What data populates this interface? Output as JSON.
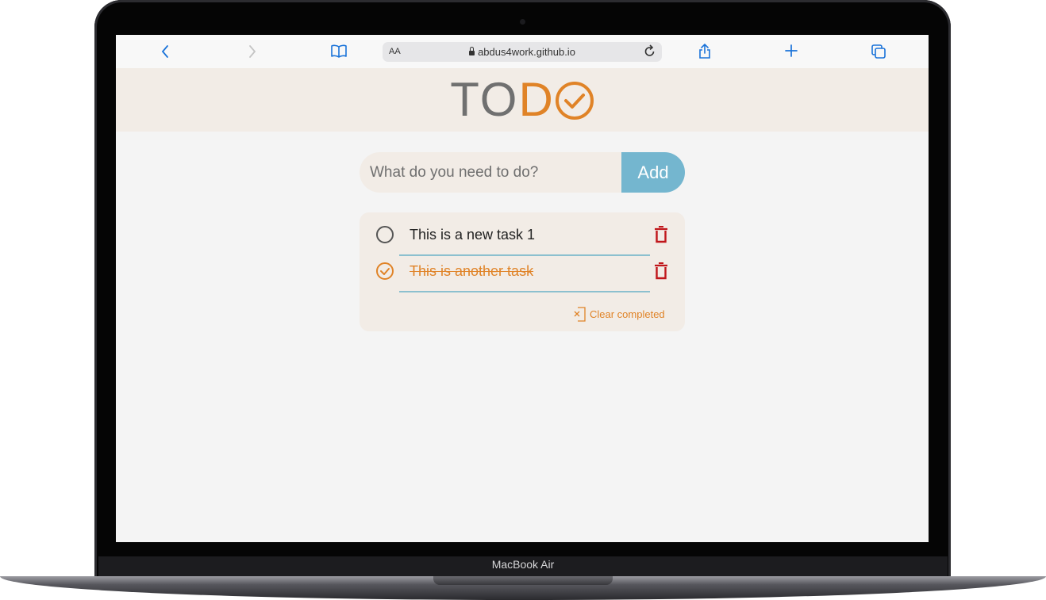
{
  "device": {
    "model_label": "MacBook Air"
  },
  "browser": {
    "url_aa": "AA",
    "url": "abdus4work.github.io",
    "icons": {
      "back": "chevron-left-icon",
      "forward": "chevron-right-icon",
      "bookmarks": "book-icon",
      "reload": "reload-icon",
      "share": "share-icon",
      "new_tab": "plus-icon",
      "tabs": "tabs-icon"
    },
    "accent": "#1a73d9"
  },
  "app": {
    "logo_grey": "TO",
    "logo_orange": "D",
    "colors": {
      "orange": "#e08327",
      "grey": "#707070",
      "blue": "#74b6cf",
      "card": "#f2ece6",
      "delete": "#c0161b"
    },
    "input_placeholder": "What do you need to do?",
    "add_label": "Add",
    "tasks": [
      {
        "text": "This is a new task 1",
        "completed": false
      },
      {
        "text": "This is another task",
        "completed": true
      }
    ],
    "clear_completed_label": "Clear completed"
  }
}
